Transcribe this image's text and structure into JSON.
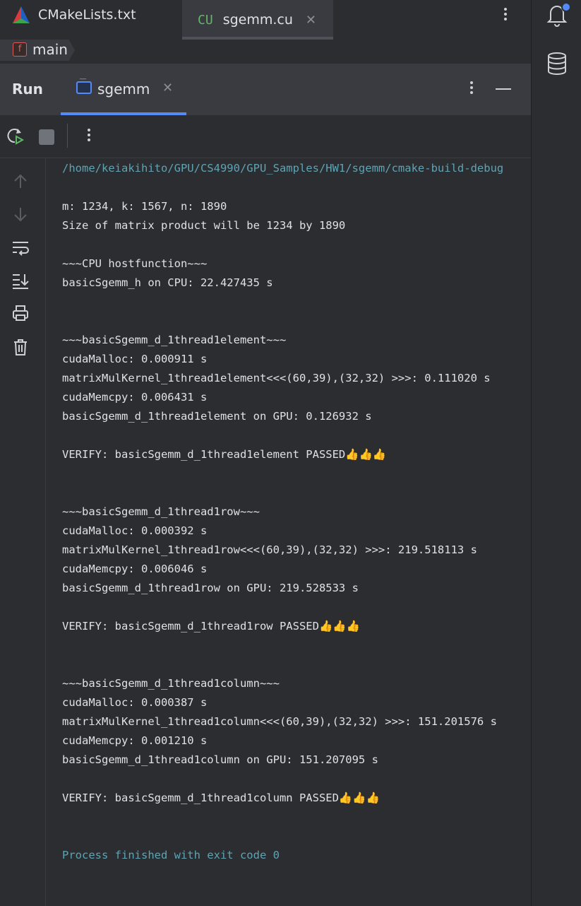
{
  "editor_tabs": [
    {
      "label": "CMakeLists.txt",
      "icon": "cmake-icon"
    },
    {
      "label": "sgemm.cu",
      "icon": "cu-file-icon",
      "icon_text": "CU",
      "active": true
    }
  ],
  "breadcrumb": {
    "label": "main",
    "icon_text": "f"
  },
  "run_panel": {
    "title": "Run",
    "tab_label": "sgemm"
  },
  "console": {
    "lines": [
      {
        "text": "/home/keiakihito/GPU/CS4990/GPU_Samples/HW1/sgemm/cmake-build-debug",
        "kind": "path"
      },
      {
        "text": "m: 1234, k: 1567, n: 1890"
      },
      {
        "text": "Size of matrix product will be 1234 by 1890"
      },
      {
        "text": "~~~CPU hostfunction~~~"
      },
      {
        "text": "basicSgemm_h on CPU: 22.427435 s"
      },
      {
        "text": "~~~basicSgemm_d_1thread1element~~~"
      },
      {
        "text": "cudaMalloc: 0.000911 s"
      },
      {
        "text": "matrixMulKernel_1thread1element<<<(60,39),(32,32) >>>: 0.111020 s"
      },
      {
        "text": "cudaMemcpy: 0.006431 s"
      },
      {
        "text": "basicSgemm_d_1thread1element on GPU: 0.126932 s"
      },
      {
        "text": "VERIFY: basicSgemm_d_1thread1element PASSED👍👍👍"
      },
      {
        "text": "~~~basicSgemm_d_1thread1row~~~"
      },
      {
        "text": "cudaMalloc: 0.000392 s"
      },
      {
        "text": "matrixMulKernel_1thread1row<<<(60,39),(32,32) >>>: 219.518113 s"
      },
      {
        "text": "cudaMemcpy: 0.006046 s"
      },
      {
        "text": "basicSgemm_d_1thread1row on GPU: 219.528533 s"
      },
      {
        "text": "VERIFY: basicSgemm_d_1thread1row PASSED👍👍👍"
      },
      {
        "text": "~~~basicSgemm_d_1thread1column~~~"
      },
      {
        "text": "cudaMalloc: 0.000387 s"
      },
      {
        "text": "matrixMulKernel_1thread1column<<<(60,39),(32,32) >>>: 151.201576 s"
      },
      {
        "text": "cudaMemcpy: 0.001210 s"
      },
      {
        "text": "basicSgemm_d_1thread1column on GPU: 151.207095 s"
      },
      {
        "text": "VERIFY: basicSgemm_d_1thread1column PASSED👍👍👍"
      },
      {
        "text": "Process finished with exit code 0",
        "kind": "exit"
      }
    ]
  },
  "colors": {
    "accent": "#548af7",
    "path_text": "#5ea4b5",
    "background": "#2b2d30"
  }
}
